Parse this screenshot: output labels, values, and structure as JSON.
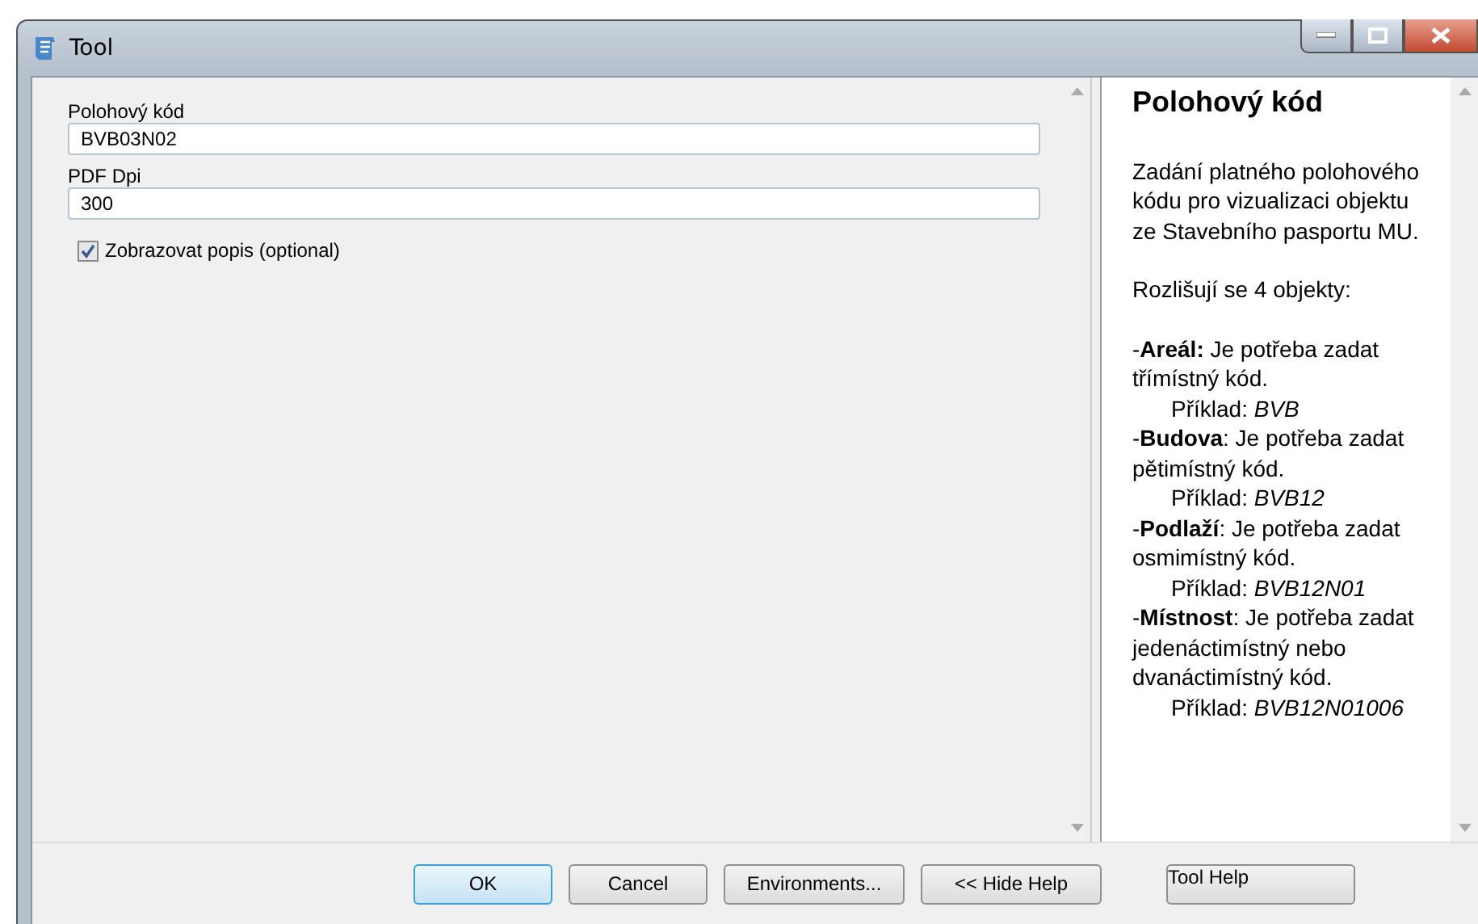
{
  "window": {
    "title": "Tool"
  },
  "fields": [
    {
      "label": "Polohový kód",
      "value": "BVB03N02"
    },
    {
      "label": "PDF Dpi",
      "value": "300"
    }
  ],
  "checkbox": {
    "label": "Zobrazovat popis (optional)",
    "checked": true
  },
  "help": {
    "title": "Polohový kód",
    "paragraphs": [
      "Zadání platného polohového kódu pro vizualizaci objektu ze Stavebního pasportu MU.",
      "Rozlišují se 4 objekty:"
    ],
    "entries": [
      {
        "text": "-**Areál:** Je potřeba zadat třímístný kód.",
        "example": "Příklad: *BVB*"
      },
      {
        "text": "-**Budova**: Je potřeba zadat pětimístný kód.",
        "example": "Příklad: *BVB12*"
      },
      {
        "text": "-**Podlaží**: Je potřeba zadat osmimístný kód.",
        "example": "Příklad: *BVB12N01*"
      },
      {
        "text": "-**Místnost**: Je potřeba zadat jedenáctimístný nebo dvanáctimístný kód.",
        "example": "Příklad: *BVB12N01006*"
      }
    ]
  },
  "buttons": [
    {
      "label": "OK",
      "kind": "default"
    },
    {
      "label": "Cancel",
      "kind": "normal"
    },
    {
      "label": "Environments...",
      "kind": "normal"
    },
    {
      "label": "<< Hide Help",
      "kind": "normal"
    },
    {
      "label": "Tool Help",
      "kind": "help"
    }
  ]
}
